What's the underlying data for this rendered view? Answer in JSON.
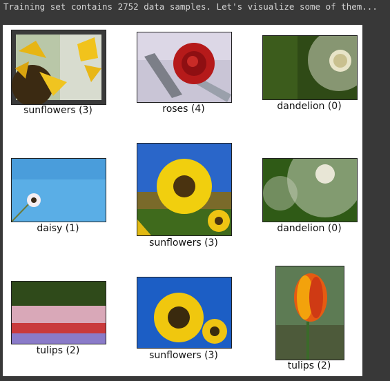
{
  "console": {
    "output_line": "Training set contains 2752 data samples. Let's visualize some of them..."
  },
  "samples": [
    {
      "label": "sunflowers (3)",
      "image": "sunflower-closeup"
    },
    {
      "label": "roses (4)",
      "image": "red-rose"
    },
    {
      "label": "dandelion (0)",
      "image": "dandelion-seedhead"
    },
    {
      "label": "daisy (1)",
      "image": "daisy-blue-sky"
    },
    {
      "label": "sunflowers (3)",
      "image": "sunflower-field"
    },
    {
      "label": "dandelion (0)",
      "image": "dandelion-seeds"
    },
    {
      "label": "tulips (2)",
      "image": "tulip-garden"
    },
    {
      "label": "sunflowers (3)",
      "image": "sunflower-blue-sky"
    },
    {
      "label": "tulips (2)",
      "image": "orange-tulip"
    }
  ]
}
